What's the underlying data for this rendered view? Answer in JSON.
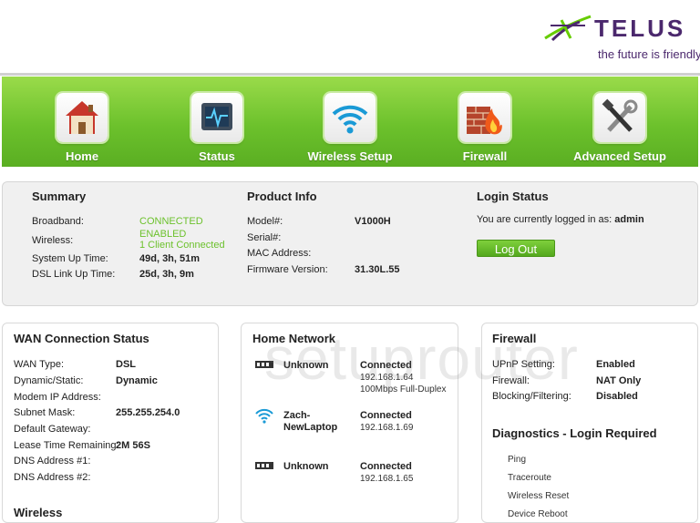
{
  "brand": {
    "name": "TELUS",
    "tagline": "the future is friendly®"
  },
  "nav": [
    {
      "label": "Home",
      "icon": "house-icon"
    },
    {
      "label": "Status",
      "icon": "monitor-icon"
    },
    {
      "label": "Wireless Setup",
      "icon": "wifi-icon"
    },
    {
      "label": "Firewall",
      "icon": "firewall-icon"
    },
    {
      "label": "Advanced Setup",
      "icon": "tools-icon"
    }
  ],
  "summary": {
    "title": "Summary",
    "rows": [
      {
        "label": "Broadband:",
        "value": "CONNECTED"
      },
      {
        "label": "Wireless:",
        "value": "ENABLED",
        "value2": "1 Client Connected"
      },
      {
        "label": "System Up Time:",
        "value": "49d, 3h, 51m"
      },
      {
        "label": "DSL Link Up Time:",
        "value": "25d, 3h, 9m"
      }
    ]
  },
  "product": {
    "title": "Product Info",
    "rows": [
      {
        "label": "Model#:",
        "value": "V1000H"
      },
      {
        "label": "Serial#:",
        "value": ""
      },
      {
        "label": "MAC Address:",
        "value": ""
      },
      {
        "label": "Firmware Version:",
        "value": "31.30L.55"
      }
    ]
  },
  "login": {
    "title": "Login Status",
    "text": "You are currently logged in as:",
    "user": "admin",
    "logout": "Log Out"
  },
  "wan": {
    "title": "WAN Connection Status",
    "rows": [
      {
        "label": "WAN Type:",
        "value": "DSL"
      },
      {
        "label": "Dynamic/Static:",
        "value": "Dynamic"
      },
      {
        "label": "Modem IP Address:",
        "value": ""
      },
      {
        "label": "Subnet Mask:",
        "value": "255.255.254.0"
      },
      {
        "label": "Default Gateway:",
        "value": ""
      },
      {
        "label": "Lease Time Remaining:",
        "value": "2M 56S"
      },
      {
        "label": "DNS Address #1:",
        "value": ""
      },
      {
        "label": "DNS Address #2:",
        "value": ""
      }
    ],
    "next_section": "Wireless"
  },
  "home_network": {
    "title": "Home Network",
    "devices": [
      {
        "name": "Unknown",
        "status": "Connected",
        "ip": "192.168.1.64",
        "extra": "100Mbps Full-Duplex",
        "icon": "ethernet-icon"
      },
      {
        "name": "Zach-",
        "name2": "NewLaptop",
        "status": "Connected",
        "ip": "192.168.1.69",
        "icon": "wifi-icon"
      },
      {
        "name": "Unknown",
        "status": "Connected",
        "ip": "192.168.1.65",
        "icon": "ethernet-icon"
      }
    ]
  },
  "firewall": {
    "title": "Firewall",
    "rows": [
      {
        "label": "UPnP Setting:",
        "value": "Enabled"
      },
      {
        "label": "Firewall:",
        "value": "NAT Only"
      },
      {
        "label": "Blocking/Filtering:",
        "value": "Disabled"
      }
    ],
    "diag_title": "Diagnostics - Login Required",
    "diag_links": [
      "Ping",
      "Traceroute",
      "Wireless Reset",
      "Device Reboot"
    ]
  },
  "watermark": "setuprouter",
  "colors": {
    "green": "#6cc12c",
    "brand_purple": "#4b286d"
  }
}
